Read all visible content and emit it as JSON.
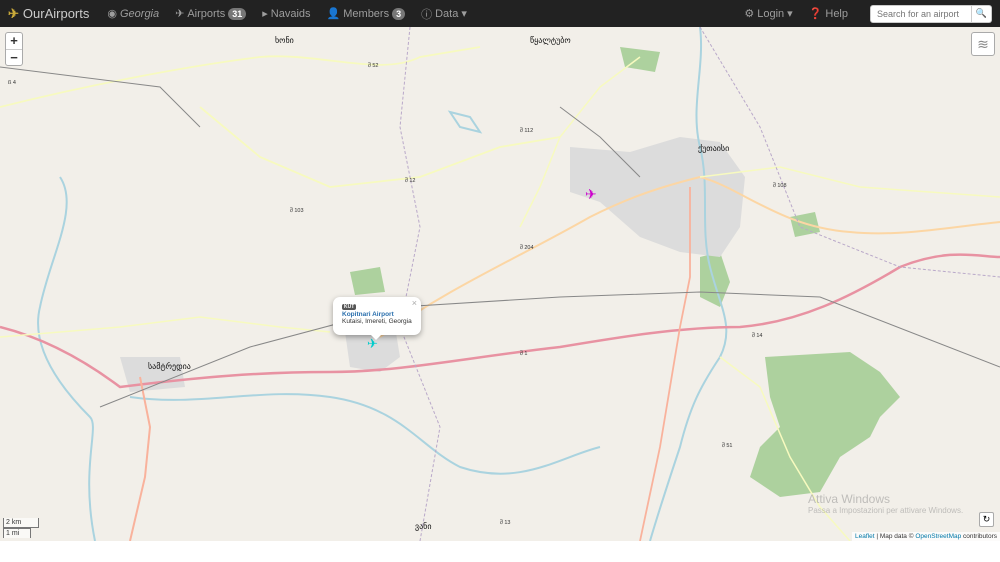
{
  "nav": {
    "brand": "OurAirports",
    "items": [
      {
        "label": "Georgia",
        "icon": "globe-icon"
      },
      {
        "label": "Airports",
        "badge": "31",
        "icon": "plane-icon"
      },
      {
        "label": "Navaids",
        "icon": "navaid-icon"
      },
      {
        "label": "Members",
        "badge": "3",
        "icon": "user-icon"
      },
      {
        "label": "Data",
        "icon": "info-icon"
      }
    ],
    "login": "Login",
    "help": "Help",
    "search_placeholder": "Search for an airport"
  },
  "map": {
    "zoom_in": "+",
    "zoom_out": "−",
    "popup": {
      "code": "KUT",
      "name": "Kopitnari Airport",
      "location": "Kutaisi, Imereti, Georgia",
      "close": "×"
    },
    "cities": [
      "ქუთაისი",
      "სამტრედია",
      "წყალტუბო",
      "ხონი",
      "ვანი"
    ],
    "roads": [
      "შ 12",
      "შ 52",
      "შ 103",
      "შ 112",
      "შ 204",
      "შ 108",
      "შ 1",
      "შ 14",
      "შ 51",
      "შ 13",
      "ß 4"
    ],
    "scale": {
      "km": "2 km",
      "mi": "1 mi"
    },
    "attribution": {
      "leaflet": "Leaflet",
      "text": " | Map data © ",
      "osm": "OpenStreetMap",
      "suffix": " contributors"
    },
    "watermark": {
      "title": "Attiva Windows",
      "sub": "Passa a Impostazioni per attivare Windows."
    }
  },
  "colors": {
    "navbar": "#222222",
    "motorway": "#e892a2",
    "trunk": "#f9b29c",
    "primary": "#fcd6a4",
    "secondary": "#f7fabf",
    "water": "#aad3df",
    "forest": "#add19e",
    "urban": "#dddddd",
    "airport_marker": "#cc00cc",
    "selected_marker": "#00cccc"
  }
}
